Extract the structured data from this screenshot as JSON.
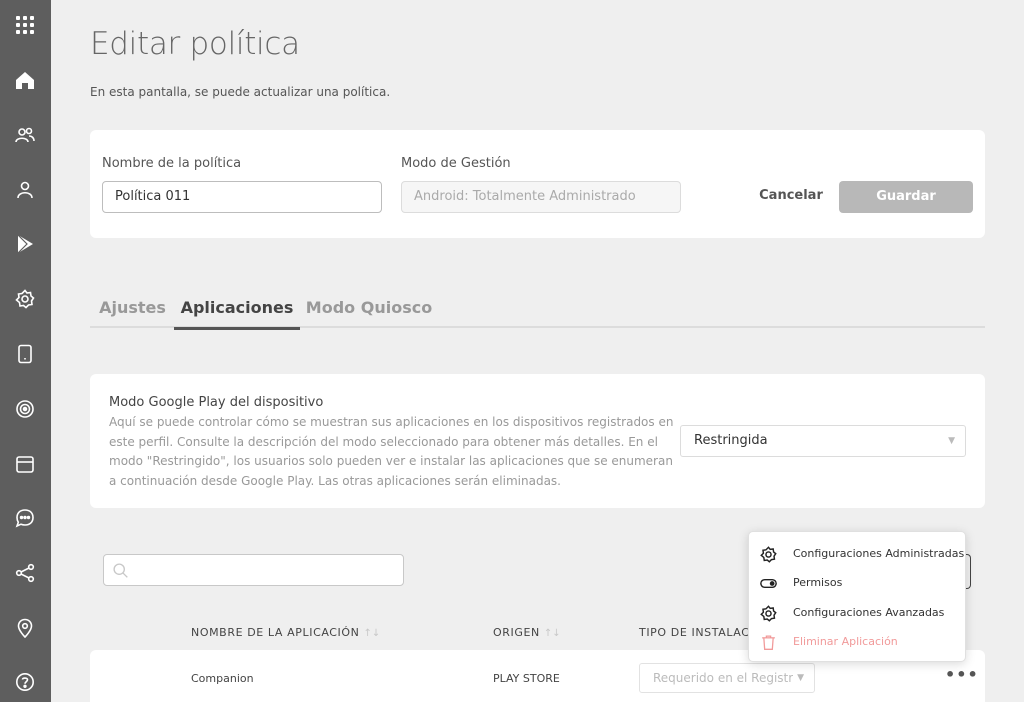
{
  "sidebar": {
    "icons": [
      "apps-grid-icon",
      "home-icon",
      "users-icon",
      "user-icon",
      "play-store-icon",
      "gear-icon",
      "device-icon",
      "radar-icon",
      "calendar-icon",
      "chat-icon",
      "share-icon",
      "location-pin-icon",
      "help-icon"
    ]
  },
  "page": {
    "title": "Editar política",
    "subtitle": "En esta pantalla, se puede actualizar una política."
  },
  "policy_form": {
    "name_label": "Nombre de la política",
    "name_value": "Política 011",
    "mode_label": "Modo de Gestión",
    "mode_placeholder": "Android: Totalmente Administrado",
    "cancel_label": "Cancelar",
    "save_label": "Guardar"
  },
  "tabs": [
    {
      "label": "Ajustes",
      "active": false
    },
    {
      "label": "Aplicaciones",
      "active": true
    },
    {
      "label": "Modo Quiosco",
      "active": false
    }
  ],
  "play_mode": {
    "title": "Modo Google Play del dispositivo",
    "description": "Aquí se puede controlar cómo se muestran sus aplicaciones en los dispositivos registrados en este perfil. Consulte la descripción del modo seleccionado para obtener más detalles. En el modo \"Restringido\", los usuarios solo pueden ver e instalar las aplicaciones que se enumeran a continuación desde Google Play. Las otras aplicaciones serán eliminadas.",
    "selected": "Restringida"
  },
  "search": {
    "placeholder": ""
  },
  "table": {
    "headers": [
      "NOMBRE DE LA APLICACIÓN",
      "ORIGEN",
      "TIPO DE INSTALACI"
    ],
    "sort_glyph": "↑↓",
    "rows": [
      {
        "name": "Companion",
        "origin": "PLAY STORE",
        "install_type": "Requerido en el Registro",
        "more": "•••"
      }
    ]
  },
  "dropdown_menu": {
    "items": [
      {
        "label": "Configuraciones Administradas",
        "icon": "gear-icon"
      },
      {
        "label": "Permisos",
        "icon": "toggle-icon"
      },
      {
        "label": "Configuraciones Avanzadas",
        "icon": "gear-icon"
      },
      {
        "label": "Eliminar Aplicación",
        "icon": "trash-icon",
        "danger": true
      }
    ]
  },
  "colors": {
    "sidebar": "#5e5e5e",
    "background": "#efefef",
    "danger": "#f19a9a",
    "disabled_button": "#b8b8b8"
  }
}
